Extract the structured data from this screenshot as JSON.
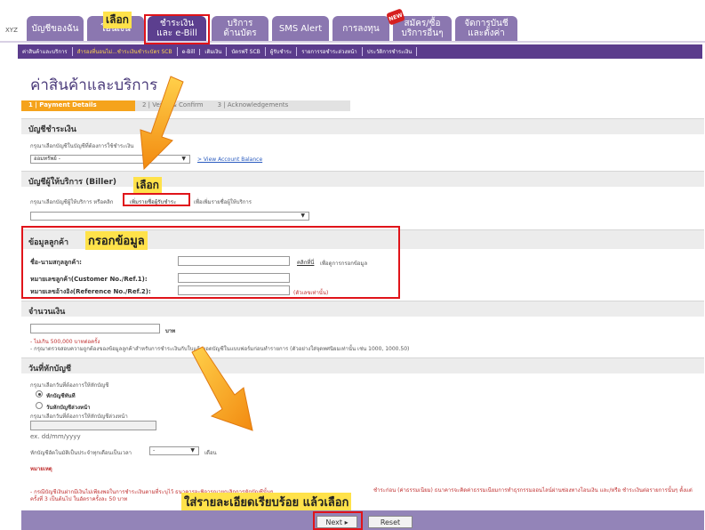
{
  "nav": {
    "brand": "XYZ",
    "tabs": [
      {
        "label": "บัญชีของฉัน"
      },
      {
        "label": "โอนเงิน"
      },
      {
        "label": "ชำระเงิน\nและ e-Bill"
      },
      {
        "label": "บริการ\nด้านบัตร"
      },
      {
        "label": "SMS Alert"
      },
      {
        "label": "การลงทุน"
      },
      {
        "label": "สมัคร/ซื้อ\nบริการอื่นๆ"
      },
      {
        "label": "จัดการบันชี\nและตั้งค่า"
      }
    ],
    "new_badge": "NEW",
    "subnav": [
      "ค่าสินค้าและบริการ",
      "สำรองที่นอนไม่...ชำระเงินชำระบัตร SCB",
      "e-Bill",
      "เติมเงิน",
      "บัตรฟรี SCB",
      "ผู้รับชำระ",
      "รายการรอชำระล่วงหน้า",
      "ประวัติการชำระเงิน"
    ]
  },
  "annotations": {
    "select_top": "เลือก",
    "select_biller": "เลือก",
    "fill_info": "กรอกข้อมูล",
    "bottom_instruction": "ใส่รายละเอียดเรียบร้อย แล้วเลือก"
  },
  "page": {
    "title": "ค่าสินค้าและบริการ"
  },
  "steps": [
    "1 | Payment Details",
    "2 | Verify & Confirm",
    "3 | Acknowledgements"
  ],
  "account": {
    "heading": "บัญชีชำระเงิน",
    "prompt": "กรุณาเลือกบัญชีในบัญชีที่ต้องการใช้ชำระเงิน",
    "selected": "ออมทรัพย์ -",
    "link": "> View Account Balance"
  },
  "biller": {
    "heading": "บัญชีผู้ให้บริการ (Biller)",
    "prompt_a": "กรุณาเลือกบัญชีผู้ให้บริการ หรือคลิก",
    "add_link": "เพิ่มรายชื่อผู้รับชำระ",
    "prompt_b": "เพื่อเพิ่มรายชื่อผู้ให้บริการ",
    "selected": ""
  },
  "customer": {
    "heading": "ข้อมูลลูกค้า",
    "name_label": "ชื่อ-นามสกุลลูกค้า:",
    "ref1_label": "หมายเลขลูกค้า(Customer No./Ref.1):",
    "ref2_label": "หมายเลขอ้างอิง(Reference No./Ref.2):",
    "click_here": "คลิกที่นี่",
    "click_note": "เพื่อดูการกรอกข้อมูล",
    "digits_only": "(ตัวเลขเท่านั้น)"
  },
  "amount": {
    "heading": "จำนวนเงิน",
    "unit": "บาท",
    "note1": "- ไม่เกิน 500,000 บาทต่อครั้ง",
    "note2": "- กรุณาตรวจสอบความถูกต้องของข้อมูลลูกค้าสำหรับการชำระเงินกับใบแจ้งยอดบัญชีในแบบฟอร์มก่อนทำรายการ (ตัวอย่างใส่จุดทศนิยมเท่านั้น เช่น 1000, 1000.50)"
  },
  "date": {
    "heading": "วันที่หักบัญชี",
    "prompt": "กรุณาเลือกวันที่ต้องการให้หักบัญชี",
    "opt_now": "หักบัญชีทันที",
    "opt_future": "วันหักบัญชีล่วงหน้า",
    "future_prompt": "กรุณาเลือกวันที่ต้องการให้หักบัญชีล่วงหน้า",
    "date_placeholder": "ex. dd/mm/yyyy",
    "recur_prompt": "หักบัญชีอัตโนมัติเป็นประจำทุกเดือนเป็นเวลา",
    "recur_value": "-",
    "recur_unit": "เดือน"
  },
  "terms": {
    "heading": "หมายเหตุ",
    "text_a": "- กรณีบัญชีเงินฝากมีเงินไม่เพียงพอในการชำระเงินตามที่ระบุไว้ ธนาคารจะพิจารณายกเลิกการหักบัญชีนั้นๆ",
    "text_b": "ครั้งที่ 3 เป็นต้นไป ในอัตราครั้งละ 50 บาท",
    "text_c": "ชำระก่อน (ค่าธรรมเนียม) ธนาคารจะคิดค่าธรรมเนียมการทำธุรกรรมออนไลน์ผ่านช่องทางโอนเงิน และ/หรือ ชำระเงินต่อรายการนั้นๆ ตั้งแต่"
  },
  "actions": {
    "next": "Next ▸",
    "reset": "Reset"
  }
}
